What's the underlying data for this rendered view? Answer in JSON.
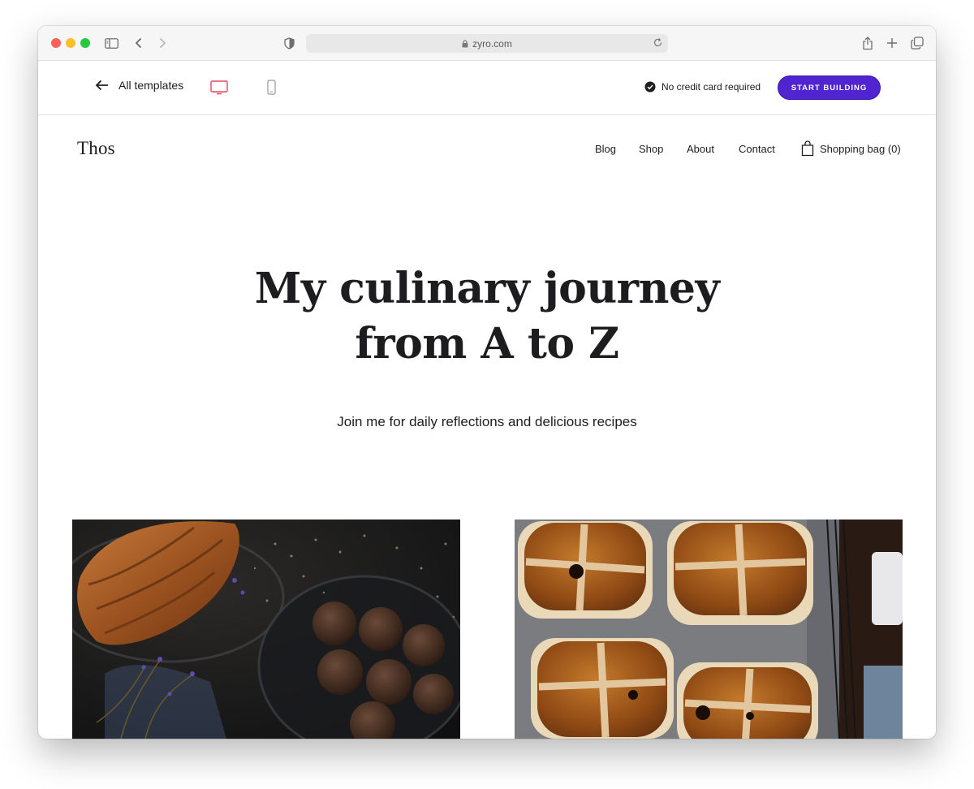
{
  "browser": {
    "url": "zyro.com"
  },
  "builder_bar": {
    "back_label": "All templates",
    "device_desktop_color": "#e8435a",
    "no_credit_card": "No credit card required",
    "cta_label": "START BUILDING",
    "cta_color": "#5025d1"
  },
  "site": {
    "logo": "Thos",
    "nav": [
      "Blog",
      "Shop",
      "About",
      "Contact"
    ],
    "cart_label": "Shopping bag (0)"
  },
  "hero": {
    "title_line1": "My culinary journey",
    "title_line2": "from A to Z",
    "subtitle": "Join me for daily reflections and delicious recipes"
  },
  "images": [
    {
      "subject": "croissant and chocolate truffles"
    },
    {
      "subject": "hot cross buns on parchment"
    }
  ]
}
